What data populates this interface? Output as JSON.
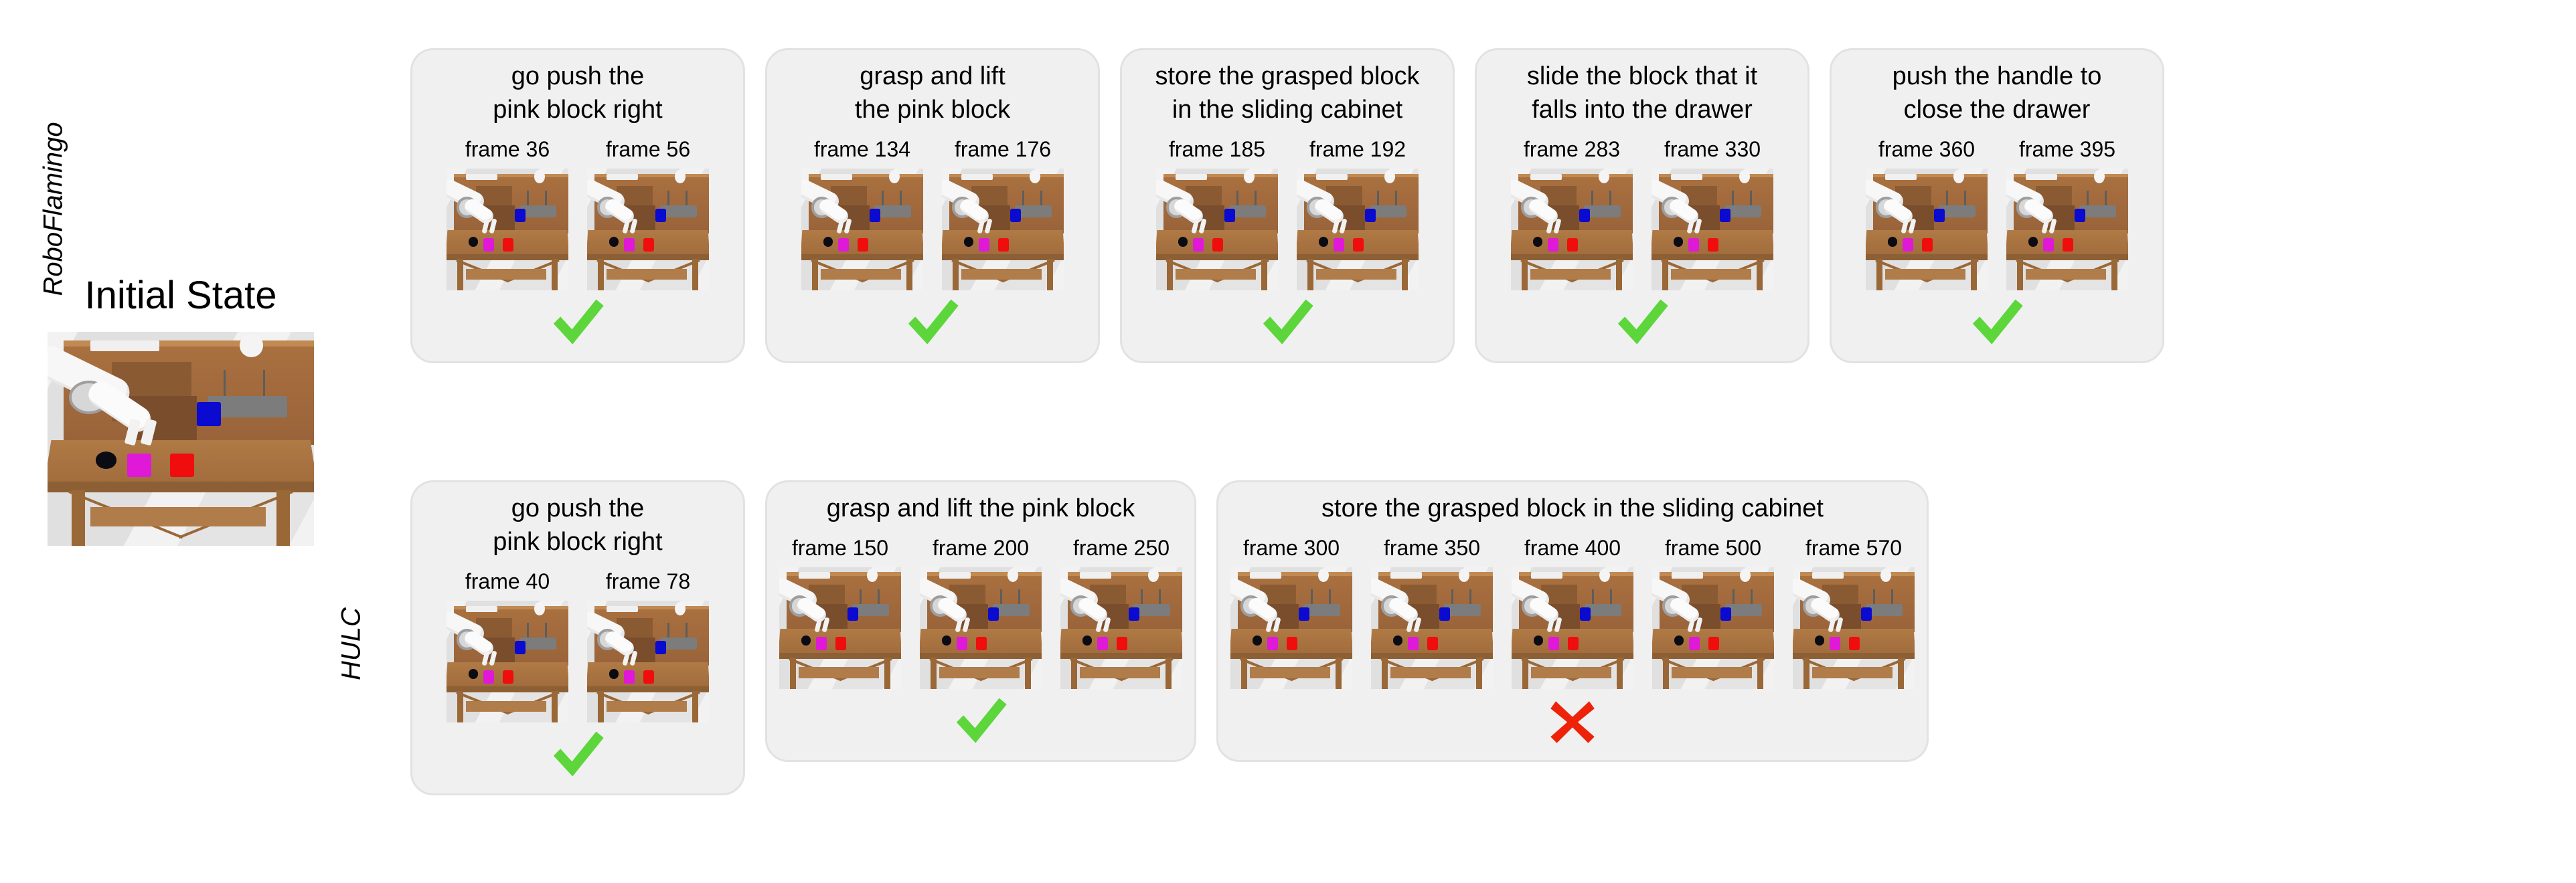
{
  "initial_state": {
    "title": "Initial State",
    "scene_id": "calvin-initial"
  },
  "rows": [
    {
      "label": "RoboFlamingo",
      "panels": [
        {
          "instruction": "go push the\npink block right",
          "frames": [
            {
              "label": "frame 36"
            },
            {
              "label": "frame 56"
            }
          ],
          "verdict": "success"
        },
        {
          "instruction": "grasp and lift\nthe pink block",
          "frames": [
            {
              "label": "frame 134"
            },
            {
              "label": "frame 176"
            }
          ],
          "verdict": "success"
        },
        {
          "instruction": "store the grasped block\nin the sliding cabinet",
          "frames": [
            {
              "label": "frame 185"
            },
            {
              "label": "frame 192"
            }
          ],
          "verdict": "success"
        },
        {
          "instruction": "slide the block that it\nfalls into the drawer",
          "frames": [
            {
              "label": "frame 283"
            },
            {
              "label": "frame 330"
            }
          ],
          "verdict": "success"
        },
        {
          "instruction": "push the handle to\nclose the drawer",
          "frames": [
            {
              "label": "frame 360"
            },
            {
              "label": "frame 395"
            }
          ],
          "verdict": "success"
        }
      ]
    },
    {
      "label": "HULC",
      "panels": [
        {
          "instruction": "go push the\npink block right",
          "frames": [
            {
              "label": "frame 40"
            },
            {
              "label": "frame 78"
            }
          ],
          "verdict": "success"
        },
        {
          "instruction": "grasp and lift the pink block",
          "frames": [
            {
              "label": "frame 150"
            },
            {
              "label": "frame 200"
            },
            {
              "label": "frame 250"
            }
          ],
          "verdict": "success"
        },
        {
          "instruction": "store the grasped block in the sliding cabinet",
          "frames": [
            {
              "label": "frame 300"
            },
            {
              "label": "frame 350"
            },
            {
              "label": "frame 400"
            },
            {
              "label": "frame 500"
            },
            {
              "label": "frame 570"
            }
          ],
          "verdict": "failure"
        }
      ]
    }
  ],
  "colors": {
    "success": "#5CD63A",
    "failure": "#ED2209",
    "panel_background": "#f0f0f0",
    "panel_border": "#e2e2e2",
    "page_background": "#ffffff",
    "text": "#000000"
  },
  "icons": {
    "success": "check-icon",
    "failure": "cross-icon"
  }
}
